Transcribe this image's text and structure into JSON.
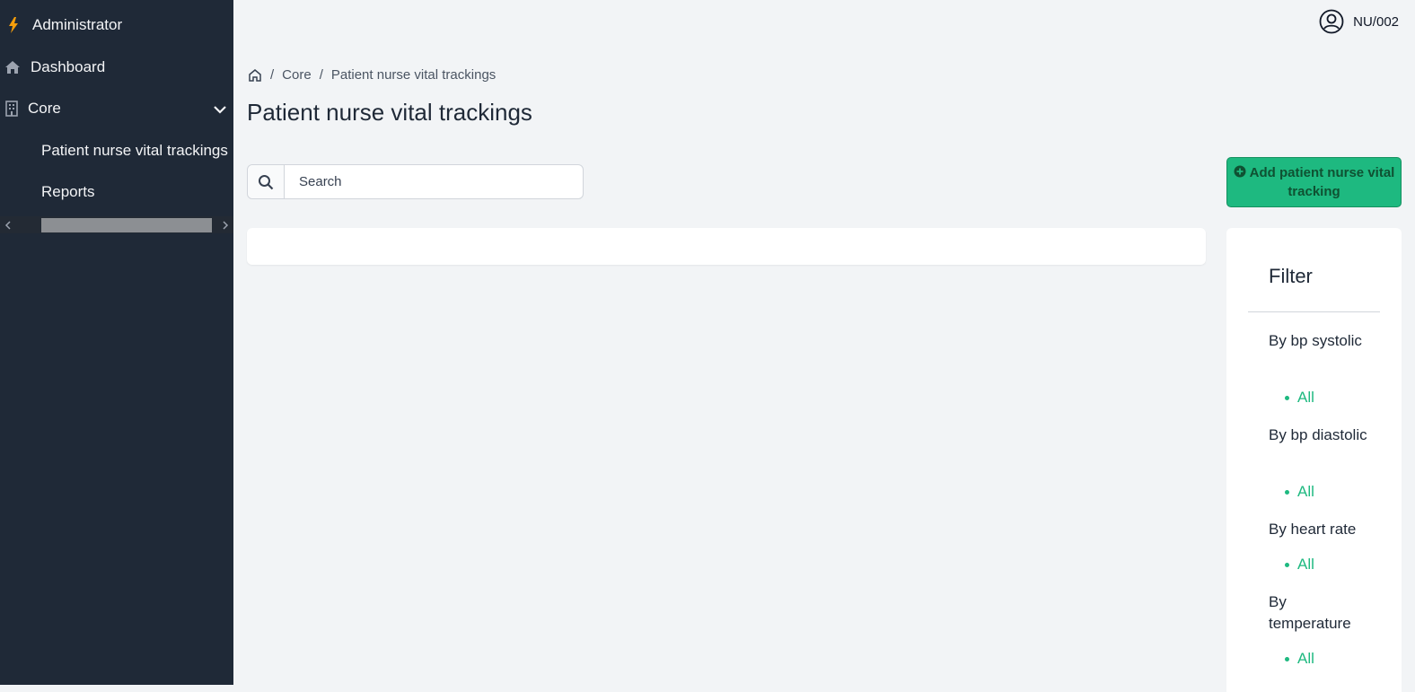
{
  "sidebar": {
    "brand": "Administrator",
    "dashboard": "Dashboard",
    "core": "Core",
    "sub_items": [
      "Patient nurse vital trackings",
      "Reports"
    ]
  },
  "user": {
    "name": "NU/002"
  },
  "breadcrumb": {
    "core": "Core",
    "current": "Patient nurse vital trackings"
  },
  "page": {
    "title": "Patient nurse vital trackings"
  },
  "search": {
    "placeholder": "Search"
  },
  "actions": {
    "add_label": "Add patient nurse vital tracking"
  },
  "filter": {
    "title": "Filter",
    "groups": [
      {
        "title": "By bp systolic",
        "option": "All"
      },
      {
        "title": "By bp diastolic",
        "option": "All"
      },
      {
        "title": "By heart rate",
        "option": "All"
      },
      {
        "title": "By temperature",
        "option": "All"
      }
    ]
  },
  "colors": {
    "sidebar": "#1f2937",
    "accent": "#1eb980",
    "brand_icon": "#f59e0b"
  }
}
